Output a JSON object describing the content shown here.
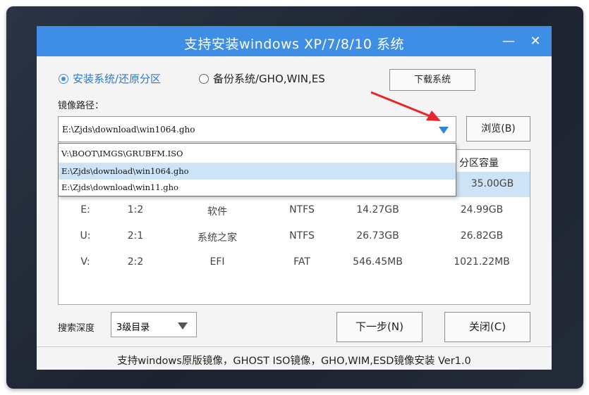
{
  "window": {
    "title": "支持安装windows XP/7/8/10 系统",
    "minimize_label": "—",
    "close_label": "✕"
  },
  "mode": {
    "option1_label": "安装系统/还原分区",
    "option2_label": "备份系统/GHO,WIN,ES",
    "selected": "option1",
    "download_button_label": "下载系统"
  },
  "image_path": {
    "label": "镜像路径：",
    "value": "E:\\Zjds\\download\\win1064.gho",
    "browse_button_label": "浏览(B)",
    "options": [
      "V:\\BOOT\\IMGS\\GRUBFM.ISO",
      "E:\\Zjds\\download\\win1064.gho",
      "E:\\Zjds\\download\\win11.gho"
    ],
    "selected_index": 1
  },
  "partition_table": {
    "visible_header": "分区容量",
    "rows": [
      {
        "drive": "",
        "part": "",
        "label": "",
        "fs": "",
        "free": "",
        "capacity": "35.00GB",
        "selected": true
      },
      {
        "drive": "E:",
        "part": "1:2",
        "label": "软件",
        "fs": "NTFS",
        "free": "14.27GB",
        "capacity": "24.99GB"
      },
      {
        "drive": "U:",
        "part": "2:1",
        "label": "系统之家",
        "fs": "NTFS",
        "free": "26.73GB",
        "capacity": "26.82GB"
      },
      {
        "drive": "V:",
        "part": "2:2",
        "label": "EFI",
        "fs": "FAT",
        "free": "546.45MB",
        "capacity": "1021.22MB"
      }
    ]
  },
  "search_depth": {
    "label": "搜索深度",
    "value": "3级目录"
  },
  "actions": {
    "next_label": "下一步(N)",
    "close_label": "关闭(C)"
  },
  "status": {
    "text": "支持windows原版镜像，GHOST ISO镜像，GHO,WIM,ESD镜像安装 Ver1.0"
  },
  "colors": {
    "titlebar": "#3e8ee5",
    "selection": "#cde4f7",
    "annotation_arrow": "#e8262a",
    "dropdown_arrow": "#2f86d8"
  }
}
